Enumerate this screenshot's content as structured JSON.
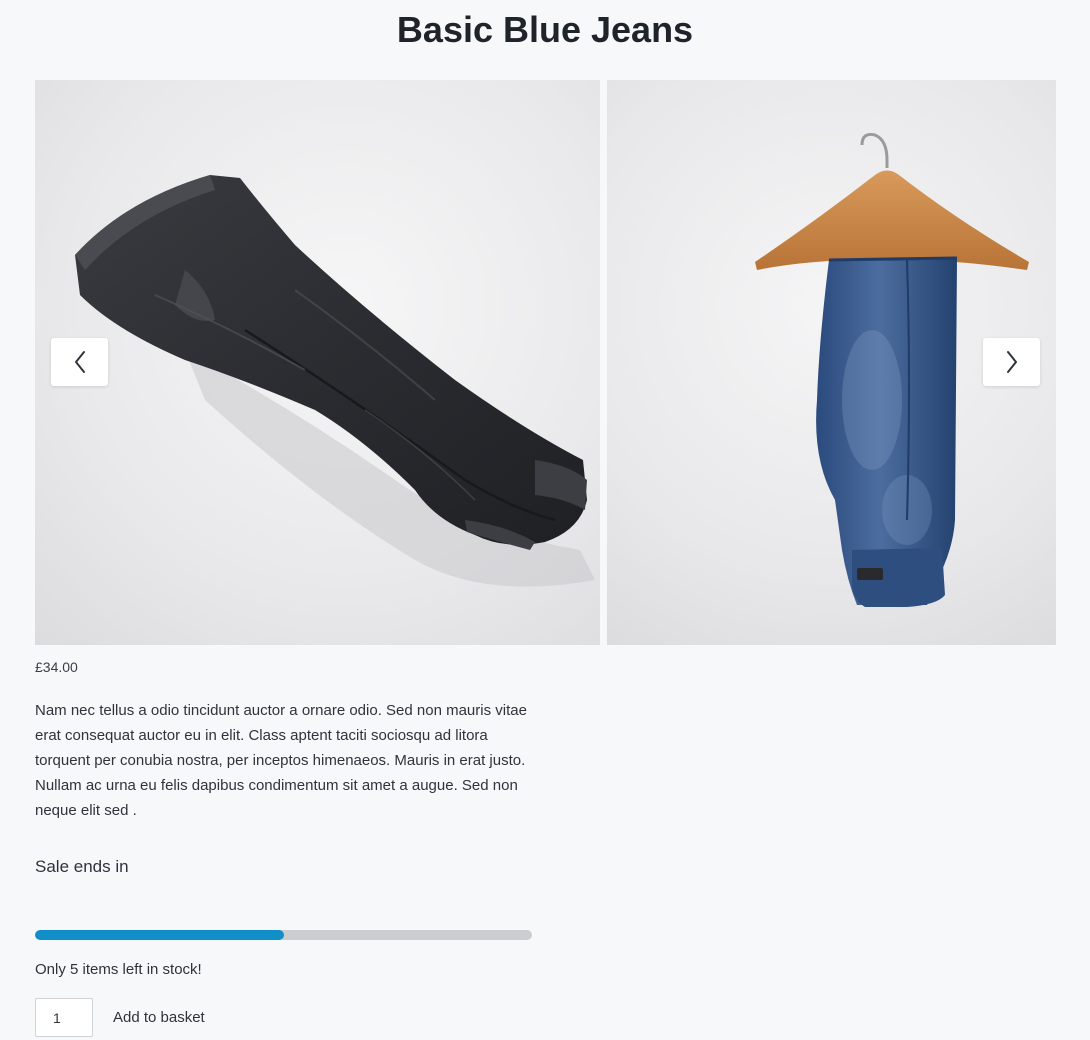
{
  "product": {
    "title": "Basic Blue Jeans",
    "price": "£34.00",
    "description": "Nam nec tellus a odio tincidunt auctor a ornare odio. Sed non mauris vitae erat consequat auctor eu in elit. Class aptent taciti sociosqu ad litora torquent per conubia nostra, per inceptos himenaeos. Mauris in erat justo. Nullam ac urna eu felis dapibus condimentum sit amet a augue. Sed non neque elit sed ."
  },
  "gallery": {
    "prev_icon": "chevron-left-icon",
    "next_icon": "chevron-right-icon",
    "slides": [
      "black-jeans-lying-flat",
      "blue-jeans-on-hanger"
    ]
  },
  "sale": {
    "label": "Sale ends in"
  },
  "stock": {
    "fill_fraction": 0.5,
    "text": "Only 5 items left in stock!",
    "bar_color": "#0f8ec7",
    "track_color": "#cccdd0"
  },
  "cart": {
    "quantity": "1",
    "add_label": "Add to basket"
  }
}
